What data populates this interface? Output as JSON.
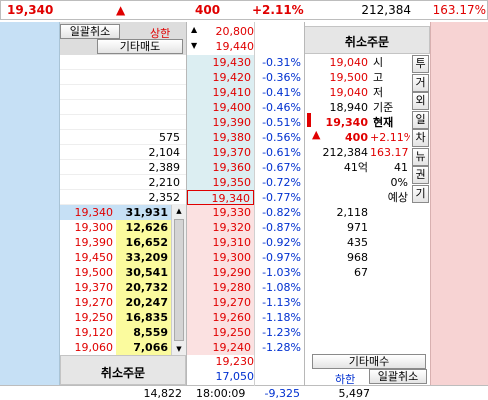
{
  "top": {
    "price": "19,340",
    "arrow": "▲",
    "change": "400",
    "rate": "+2.11%",
    "volume": "212,384",
    "vol_rate": "163.17%"
  },
  "buttons": {
    "cancel_all_top": "일괄취소",
    "upper_limit": "상한",
    "other_sell": "기타매도",
    "cancel_order_right": "취소주문",
    "cancel_order_bottom": "취소주문",
    "other_buy": "기타매수",
    "lower_limit": "하한",
    "cancel_all_bottom": "일괄취소"
  },
  "limit_prices": {
    "upper": "20,800",
    "first": "19,440"
  },
  "ask_rows": [
    {
      "vol": "",
      "price": "19,430",
      "rate": "-0.31%"
    },
    {
      "vol": "",
      "price": "19,420",
      "rate": "-0.36%"
    },
    {
      "vol": "",
      "price": "19,410",
      "rate": "-0.41%"
    },
    {
      "vol": "",
      "price": "19,400",
      "rate": "-0.46%"
    },
    {
      "vol": "",
      "price": "19,390",
      "rate": "-0.51%"
    },
    {
      "vol": "575",
      "price": "19,380",
      "rate": "-0.56%"
    },
    {
      "vol": "2,104",
      "price": "19,370",
      "rate": "-0.61%"
    },
    {
      "vol": "2,389",
      "price": "19,360",
      "rate": "-0.67%"
    },
    {
      "vol": "2,210",
      "price": "19,350",
      "rate": "-0.72%"
    },
    {
      "vol": "2,352",
      "price": "19,340",
      "rate": "-0.77%"
    }
  ],
  "info": [
    {
      "val": "19,040",
      "label": "시"
    },
    {
      "val": "19,500",
      "label": "고"
    },
    {
      "val": "19,040",
      "label": "저"
    },
    {
      "val": "18,940",
      "label": "기준"
    },
    {
      "val": "19,340",
      "label": "현재"
    },
    {
      "val": "400",
      "rate": "+2.11%"
    },
    {
      "val": "212,384",
      "rate": "163.17"
    },
    {
      "val": "41억",
      "rate": "41"
    },
    {
      "val": "",
      "rate": "0%"
    },
    {
      "val": "",
      "rate": "예상"
    }
  ],
  "side_tabs": [
    "투",
    "거",
    "외",
    "일",
    "차",
    "뉴",
    "권",
    "기"
  ],
  "bid_rows": [
    {
      "p": "19,340",
      "v": "31,931",
      "price": "19,330",
      "rate": "-0.82%",
      "bid": "2,118"
    },
    {
      "p": "19,300",
      "v": "12,626",
      "price": "19,320",
      "rate": "-0.87%",
      "bid": "971"
    },
    {
      "p": "19,390",
      "v": "16,652",
      "price": "19,310",
      "rate": "-0.92%",
      "bid": "435"
    },
    {
      "p": "19,450",
      "v": "33,209",
      "price": "19,300",
      "rate": "-0.97%",
      "bid": "968"
    },
    {
      "p": "19,500",
      "v": "30,541",
      "price": "19,290",
      "rate": "-1.03%",
      "bid": "67"
    },
    {
      "p": "19,370",
      "v": "20,732",
      "price": "19,280",
      "rate": "-1.08%",
      "bid": ""
    },
    {
      "p": "19,270",
      "v": "20,247",
      "price": "19,270",
      "rate": "-1.13%",
      "bid": ""
    },
    {
      "p": "19,250",
      "v": "16,835",
      "price": "19,260",
      "rate": "-1.18%",
      "bid": ""
    },
    {
      "p": "19,120",
      "v": "8,559",
      "price": "19,250",
      "rate": "-1.23%",
      "bid": ""
    },
    {
      "p": "19,060",
      "v": "7,066",
      "price": "19,240",
      "rate": "-1.28%",
      "bid": ""
    }
  ],
  "bottom": {
    "price_a": "19,230",
    "price_b": "17,050",
    "ask_total": "14,822",
    "time": "18:00:09",
    "diff": "-9,325",
    "bid_total": "5,497"
  },
  "colors": {
    "up": "#e00000",
    "down": "#0030d0",
    "ask_bg": "#c6e0f5",
    "bid_bg": "#f7d3d3",
    "price_ask_bg": "#dceef2",
    "price_bid_bg": "#fbe1e1",
    "highlight": "#fbfb9e"
  }
}
